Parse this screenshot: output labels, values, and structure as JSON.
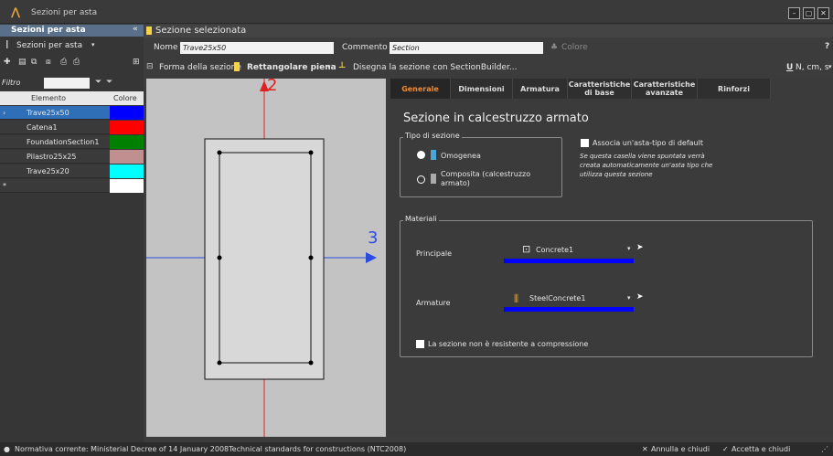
{
  "window": {
    "title": "Sezioni per asta"
  },
  "left": {
    "header": "Sezioni per asta",
    "toolbar_label": "Sezioni per asta",
    "filter_label": "Filtro",
    "col_element": "Elemento",
    "col_color": "Colore",
    "rows": [
      {
        "name": "Trave25x50",
        "color": "#0000ff"
      },
      {
        "name": "Catena1",
        "color": "#ff0000"
      },
      {
        "name": "FoundationSection1",
        "color": "#008000"
      },
      {
        "name": "Pilastro25x25",
        "color": "#c09090"
      },
      {
        "name": "Trave25x20",
        "color": "#00ffff"
      }
    ]
  },
  "main": {
    "header": "Sezione selezionata",
    "name_label": "Nome",
    "name_value": "Trave25x50",
    "comment_label": "Commento",
    "comment_value": "Section",
    "color_label": "Colore",
    "shape_label": "Forma della sezione",
    "shape_value": "Rettangolare piena",
    "builder_label": "Disegna la sezione con SectionBuilder...",
    "units": "N, cm, s"
  },
  "canvas": {
    "axis2": "2",
    "axis3": "3"
  },
  "tabs": [
    "Generale",
    "Dimensioni",
    "Armatura",
    "Caratteristiche di base",
    "Caratteristiche avanzate",
    "Rinforzi"
  ],
  "panel": {
    "title": "Sezione in calcestruzzo armato",
    "type_group": "Tipo di sezione",
    "opt1": "Omogenea",
    "opt2": "Composita (calcestruzzo armato)",
    "assoc_label": "Associa un'asta-tipo di default",
    "assoc_note": "Se questa casella viene spuntata verrà creata automaticamente un'asta tipo che utilizza questa sezione",
    "materials_group": "Materiali",
    "principal_label": "Principale",
    "principal_value": "Concrete1",
    "rebar_label": "Armature",
    "rebar_value": "SteelConcrete1",
    "compression_label": "La sezione non è resistente a compressione"
  },
  "status": {
    "text": "Normativa corrente: Ministerial Decree of 14 January 2008Technical standards for constructions (NTC2008)",
    "cancel": "Annulla e chiudi",
    "accept": "Accetta e chiudi"
  }
}
